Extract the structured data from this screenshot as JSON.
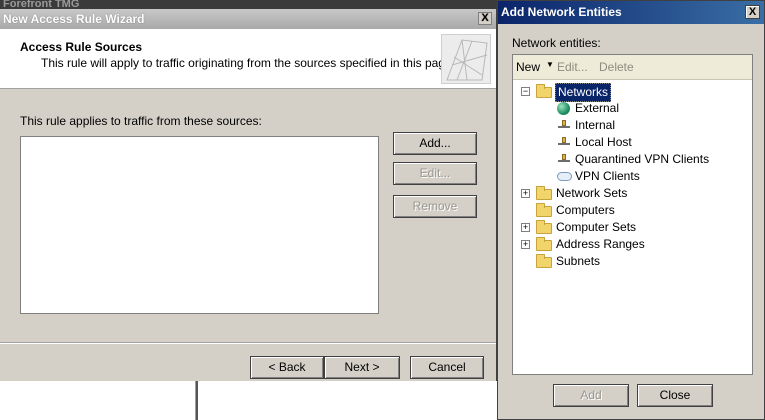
{
  "background": {
    "app_title": "Forefront TMG"
  },
  "wizard": {
    "title": "New Access Rule Wizard",
    "close_label": "X",
    "header_title": "Access Rule Sources",
    "header_description": "This rule will apply to traffic originating from the sources specified in this page.",
    "sources_label": "This rule applies to traffic from these sources:",
    "buttons": {
      "add": "Add...",
      "edit": "Edit...",
      "remove": "Remove"
    },
    "footer": {
      "back": "< Back",
      "next": "Next >",
      "cancel": "Cancel"
    }
  },
  "dialog": {
    "title": "Add Network Entities",
    "close_label": "X",
    "entities_label": "Network entities:",
    "toolbar": {
      "new": "New",
      "edit": "Edit...",
      "delete": "Delete"
    },
    "tree": {
      "networks": "Networks",
      "network_children": [
        "External",
        "Internal",
        "Local Host",
        "Quarantined VPN Clients",
        "VPN Clients"
      ],
      "network_sets": "Network Sets",
      "computers": "Computers",
      "computer_sets": "Computer Sets",
      "address_ranges": "Address Ranges",
      "subnets": "Subnets"
    },
    "buttons": {
      "add": "Add",
      "close": "Close"
    }
  },
  "colors": {
    "dialog_titlebar": "#0a246a",
    "selection": "#0a246a",
    "window_face": "#d4d0c8"
  }
}
